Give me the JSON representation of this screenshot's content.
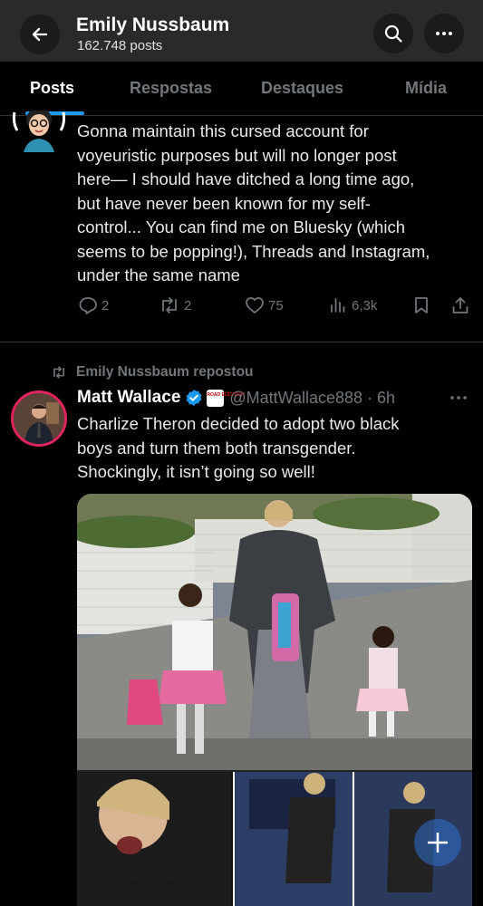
{
  "header": {
    "title": "Emily Nussbaum",
    "post_count": "162.748 posts"
  },
  "tabs": [
    {
      "label": "Posts"
    },
    {
      "label": "Respostas"
    },
    {
      "label": "Destaques"
    },
    {
      "label": "Mídia"
    }
  ],
  "post1": {
    "lines": [
      "Gonna maintain this cursed account for",
      "voyeuristic purposes but will no longer post",
      "here— I should have ditched a long time ago,",
      "but have never been known for my self-",
      "control... You can find me on Bluesky (which",
      "seems to be popping!), Threads and Instagram,",
      "under the same name"
    ],
    "replies": "2",
    "reposts": "2",
    "likes": "75",
    "views": "6,3k"
  },
  "post2": {
    "repost_label": "Emily Nussbaum repostou",
    "author": "Matt Wallace",
    "handle_time": "@MattWallace888 · 6h",
    "org_badge": "ROAD ELECTION",
    "lines": [
      "Charlize Theron decided to adopt two black",
      "boys and turn them both transgender.",
      "Shockingly, it isn’t going so well!"
    ]
  },
  "colors": {
    "accent": "#1d9bf0",
    "muted": "#71767b",
    "background": "#000000",
    "header_bg": "#2a2a2c",
    "avatar_ring": "#e0245e"
  }
}
